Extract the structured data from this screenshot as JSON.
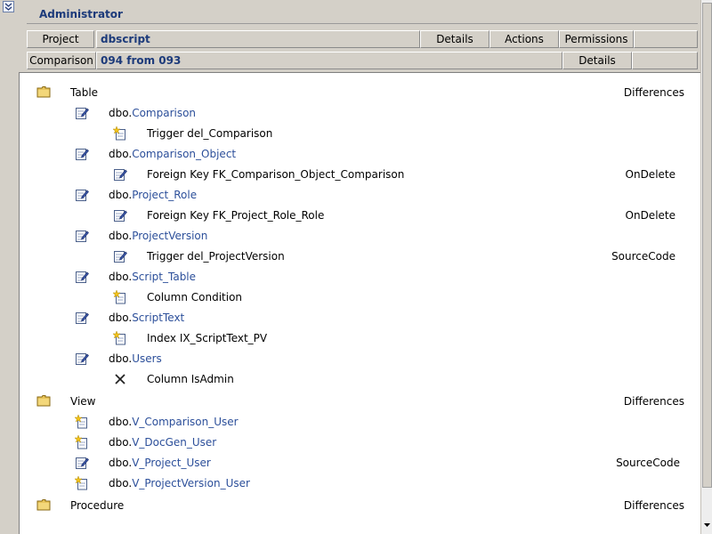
{
  "header": {
    "user": "Administrator",
    "project_label": "Project",
    "project_value": "dbscript",
    "details_label": "Details",
    "actions_label": "Actions",
    "permissions_label": "Permissions",
    "comparison_label": "Comparison",
    "comparison_value": "094 from 093",
    "comparison_details_label": "Details"
  },
  "groups": [
    {
      "name": "Table",
      "diff_label": "Differences",
      "items": [
        {
          "schema": "dbo.",
          "name": "Comparison",
          "icon": "edit-icon",
          "children": [
            {
              "icon": "new-icon",
              "text": "Trigger del_Comparison",
              "diff": ""
            }
          ]
        },
        {
          "schema": "dbo.",
          "name": "Comparison_Object",
          "icon": "edit-icon",
          "children": [
            {
              "icon": "edit-icon",
              "text": "Foreign Key FK_Comparison_Object_Comparison",
              "diff": "OnDelete"
            }
          ]
        },
        {
          "schema": "dbo.",
          "name": "Project_Role",
          "icon": "edit-icon",
          "children": [
            {
              "icon": "edit-icon",
              "text": "Foreign Key FK_Project_Role_Role",
              "diff": "OnDelete"
            }
          ]
        },
        {
          "schema": "dbo.",
          "name": "ProjectVersion",
          "icon": "edit-icon",
          "children": [
            {
              "icon": "edit-icon",
              "text": "Trigger del_ProjectVersion",
              "diff": "SourceCode"
            }
          ]
        },
        {
          "schema": "dbo.",
          "name": "Script_Table",
          "icon": "edit-icon",
          "children": [
            {
              "icon": "new-icon",
              "text": "Column Condition",
              "diff": ""
            }
          ]
        },
        {
          "schema": "dbo.",
          "name": "ScriptText",
          "icon": "edit-icon",
          "children": [
            {
              "icon": "new-icon",
              "text": "Index IX_ScriptText_PV",
              "diff": ""
            }
          ]
        },
        {
          "schema": "dbo.",
          "name": "Users",
          "icon": "edit-icon",
          "children": [
            {
              "icon": "delete-icon",
              "text": "Column IsAdmin",
              "diff": ""
            }
          ]
        }
      ]
    },
    {
      "name": "View",
      "diff_label": "Differences",
      "items": [
        {
          "schema": "dbo.",
          "name": "V_Comparison_User",
          "icon": "new-icon",
          "diff": "",
          "children": []
        },
        {
          "schema": "dbo.",
          "name": "V_DocGen_User",
          "icon": "new-icon",
          "diff": "",
          "children": []
        },
        {
          "schema": "dbo.",
          "name": "V_Project_User",
          "icon": "edit-icon",
          "diff": "SourceCode",
          "children": []
        },
        {
          "schema": "dbo.",
          "name": "V_ProjectVersion_User",
          "icon": "new-icon",
          "diff": "",
          "children": []
        }
      ]
    },
    {
      "name": "Procedure",
      "diff_label": "Differences",
      "items": []
    }
  ],
  "colors": {
    "accent": "#1c3a7a",
    "link": "#2c4f9a",
    "panel": "#d4d0c8"
  }
}
